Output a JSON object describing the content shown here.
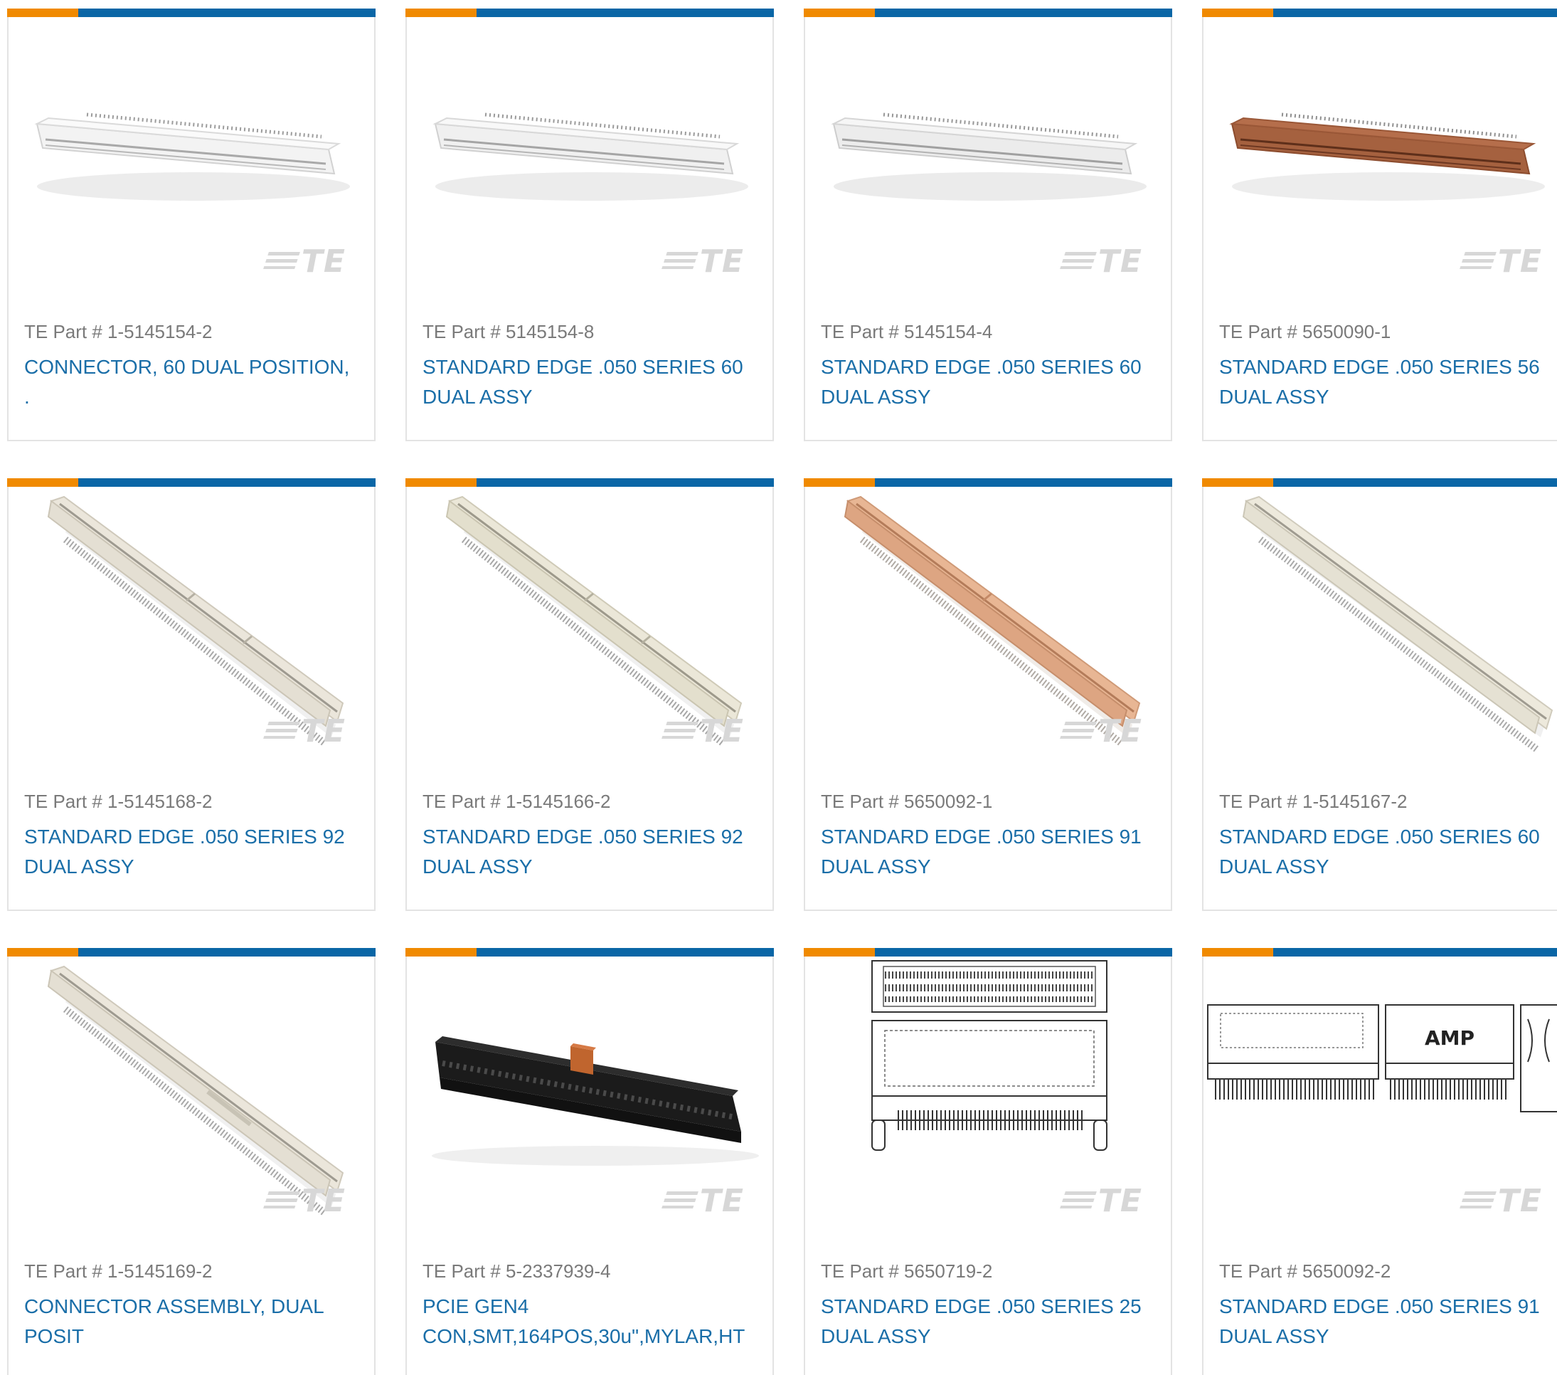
{
  "brand_colors": {
    "accent_orange": "#f08a00",
    "accent_blue": "#0a66a6",
    "link": "#1a6ea8",
    "muted": "#7a7a7a"
  },
  "watermark": "TE",
  "products": [
    {
      "part_label": "TE Part # 1-5145154-2",
      "title": "CONNECTOR, 60 DUAL POSITION, .",
      "image": "horizontal-connector-white-icon"
    },
    {
      "part_label": "TE Part # 5145154-8",
      "title": "STANDARD EDGE .050 SERIES 60 DUAL ASSY",
      "image": "horizontal-connector-white-icon"
    },
    {
      "part_label": "TE Part # 5145154-4",
      "title": "STANDARD EDGE .050 SERIES 60 DUAL ASSY",
      "image": "horizontal-connector-white-icon"
    },
    {
      "part_label": "TE Part # 5650090-1",
      "title": "STANDARD EDGE .050 SERIES 56 DUAL ASSY",
      "image": "horizontal-connector-brown-icon"
    },
    {
      "part_label": "TE Part # 1-5145168-2",
      "title": "STANDARD EDGE .050 SERIES 92 DUAL ASSY",
      "image": "diagonal-connector-cream-icon"
    },
    {
      "part_label": "TE Part # 1-5145166-2",
      "title": "STANDARD EDGE .050 SERIES 92 DUAL ASSY",
      "image": "diagonal-connector-cream-icon"
    },
    {
      "part_label": "TE Part # 5650092-1",
      "title": "STANDARD EDGE .050 SERIES 91 DUAL ASSY",
      "image": "diagonal-connector-tan-icon"
    },
    {
      "part_label": "TE Part # 1-5145167-2",
      "title": "STANDARD EDGE .050 SERIES 60 DUAL ASSY",
      "image": "diagonal-connector-cream-icon"
    },
    {
      "part_label": "TE Part # 1-5145169-2",
      "title": "CONNECTOR ASSEMBLY, DUAL POSIT",
      "image": "diagonal-connector-cream-icon"
    },
    {
      "part_label": "TE Part # 5-2337939-4",
      "title": "PCIE GEN4 CON,SMT,164POS,30u\",MYLAR,HT",
      "image": "pcie-connector-black-icon"
    },
    {
      "part_label": "TE Part # 5650719-2",
      "title": "STANDARD EDGE .050 SERIES 25 DUAL ASSY",
      "image": "connector-line-drawing-icon"
    },
    {
      "part_label": "TE Part # 5650092-2",
      "title": "STANDARD EDGE .050 SERIES 91 DUAL ASSY",
      "image": "amp-connector-drawing-icon",
      "drawing_label": "AMP"
    }
  ]
}
